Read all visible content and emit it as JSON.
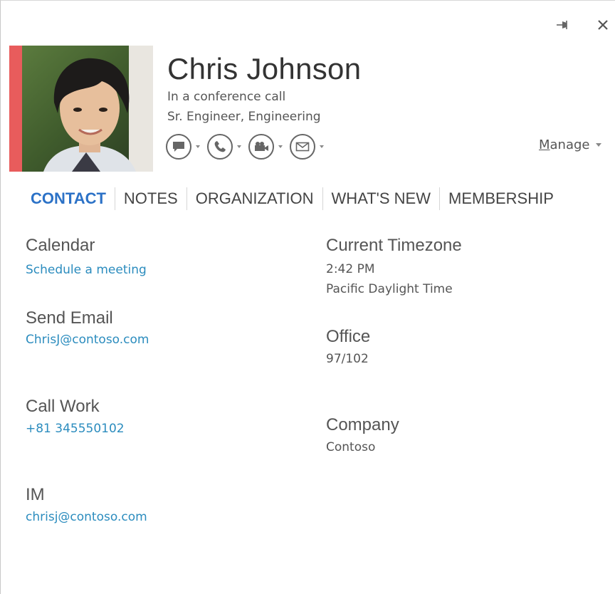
{
  "window": {
    "pin_icon": "pin-icon",
    "close_icon": "close-icon"
  },
  "presence_color": "#e85c5c",
  "accent_color": "#2c72c7",
  "link_color": "#2b8cbe",
  "contact": {
    "name": "Chris Johnson",
    "status": "In a conference call",
    "title": "Sr. Engineer, Engineering"
  },
  "actions": [
    {
      "icon": "chat-bubble-icon"
    },
    {
      "icon": "phone-icon"
    },
    {
      "icon": "video-camera-icon"
    },
    {
      "icon": "email-icon"
    }
  ],
  "manage": {
    "accel": "M",
    "rest": "anage"
  },
  "tabs": [
    {
      "label": "CONTACT",
      "active": true
    },
    {
      "label": "NOTES"
    },
    {
      "label": "ORGANIZATION"
    },
    {
      "label": "WHAT'S NEW"
    },
    {
      "label": "MEMBERSHIP"
    }
  ],
  "details": {
    "calendar": {
      "label": "Calendar",
      "link": "Schedule a meeting"
    },
    "email": {
      "label": "Send Email",
      "link": "ChrisJ@contoso.com"
    },
    "call": {
      "label": "Call Work",
      "link": "+81 345550102"
    },
    "im": {
      "label": "IM",
      "link": "chrisj@contoso.com"
    },
    "timezone": {
      "label": "Current Timezone",
      "time": "2:42 PM",
      "zone": "Pacific Daylight Time"
    },
    "office": {
      "label": "Office",
      "value": "97/102"
    },
    "company": {
      "label": "Company",
      "value": "Contoso"
    }
  }
}
